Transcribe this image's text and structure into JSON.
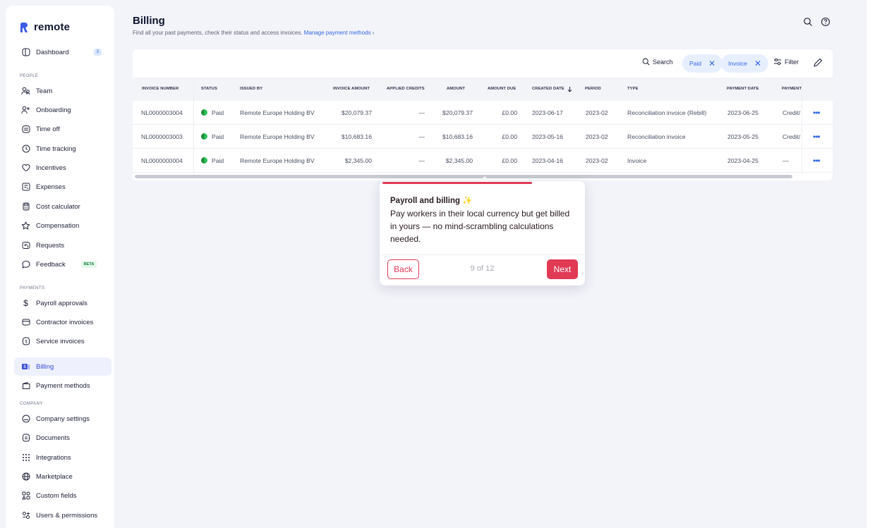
{
  "app": {
    "name": "remote"
  },
  "sidebar": {
    "dashboard": {
      "label": "Dashboard",
      "count": "3"
    },
    "people_label": "PEOPLE",
    "people": [
      {
        "label": "Team",
        "icon": "team-icon"
      },
      {
        "label": "Onboarding",
        "icon": "user-plus-icon"
      },
      {
        "label": "Time off",
        "icon": "calendar-icon"
      },
      {
        "label": "Time tracking",
        "icon": "clock-icon"
      },
      {
        "label": "Incentives",
        "icon": "heart-icon"
      },
      {
        "label": "Expenses",
        "icon": "receipt-icon"
      },
      {
        "label": "Cost calculator",
        "icon": "calculator-icon"
      },
      {
        "label": "Compensation",
        "icon": "star-icon"
      },
      {
        "label": "Requests",
        "icon": "request-icon"
      },
      {
        "label": "Feedback",
        "icon": "chat-icon",
        "badge": "BETA"
      }
    ],
    "payments_label": "PAYMENTS",
    "payments": [
      {
        "label": "Payroll approvals",
        "icon": "dollar-icon"
      },
      {
        "label": "Contractor invoices",
        "icon": "card-icon"
      },
      {
        "label": "Service invoices",
        "icon": "invoice-icon"
      },
      {
        "label": "Billing",
        "icon": "billing-icon"
      },
      {
        "label": "Payment methods",
        "icon": "wallet-icon"
      }
    ],
    "company_label": "COMPANY",
    "company": [
      {
        "label": "Company settings",
        "icon": "building-icon"
      },
      {
        "label": "Documents",
        "icon": "document-icon"
      },
      {
        "label": "Integrations",
        "icon": "grid-icon"
      },
      {
        "label": "Marketplace",
        "icon": "globe-icon"
      },
      {
        "label": "Custom fields",
        "icon": "fields-icon"
      },
      {
        "label": "Users & permissions",
        "icon": "permissions-icon"
      }
    ]
  },
  "header": {
    "title": "Billing",
    "subtitle": "Find all your past payments, check their status and access invoices.",
    "link": "Manage payment methods ›"
  },
  "toolbar": {
    "search_label": "Search",
    "chips": [
      "Paid",
      "Invoice"
    ],
    "filter_label": "Filter"
  },
  "table": {
    "columns": [
      "INVOICE NUMBER",
      "STATUS",
      "ISSUED BY",
      "INVOICE AMOUNT",
      "APPLIED CREDITS",
      "AMOUNT",
      "AMOUNT DUE",
      "CREATED DATE",
      "PERIOD",
      "TYPE",
      "PAYMENT DATE",
      "PAYMENT"
    ],
    "rows": [
      {
        "invoice_number": "NL0000003004",
        "status": "Paid",
        "issued_by": "Remote Europe Holding BV",
        "invoice_amount": "$20,079.37",
        "applied_credits": "—",
        "amount": "$20,079.37",
        "amount_due": "£0.00",
        "created_date": "2023-06-17",
        "period": "2023-02",
        "type": "Reconciliation invoice (Rebill)",
        "payment_date": "2023-06-25",
        "payment": "Credit/"
      },
      {
        "invoice_number": "NL0000003003",
        "status": "Paid",
        "issued_by": "Remote Europe Holding BV",
        "invoice_amount": "$10,683.16",
        "applied_credits": "—",
        "amount": "$10,683.16",
        "amount_due": "£0.00",
        "created_date": "2023-05-16",
        "period": "2023-02",
        "type": "Reconciliation invoice",
        "payment_date": "2023-05-25",
        "payment": "Credit/"
      },
      {
        "invoice_number": "NL0000000004",
        "status": "Paid",
        "issued_by": "Remote Europe Holding BV",
        "invoice_amount": "$2,345.00",
        "applied_credits": "—",
        "amount": "$2,345.00",
        "amount_due": "£0.00",
        "created_date": "2023-04-16",
        "period": "2023-02",
        "type": "Invoice",
        "payment_date": "2023-04-25",
        "payment": "—"
      }
    ]
  },
  "tour": {
    "title": "Payroll and billing ✨",
    "body": "Pay workers in their local currency but get billed in yours — no mind-scrambling calculations needed.",
    "back_label": "Back",
    "next_label": "Next",
    "step": "9 of 12",
    "progress": 0.75
  },
  "colors": {
    "accent": "#3567e6",
    "tour_accent": "#e03a55",
    "paid_green": "#2ec55a"
  }
}
